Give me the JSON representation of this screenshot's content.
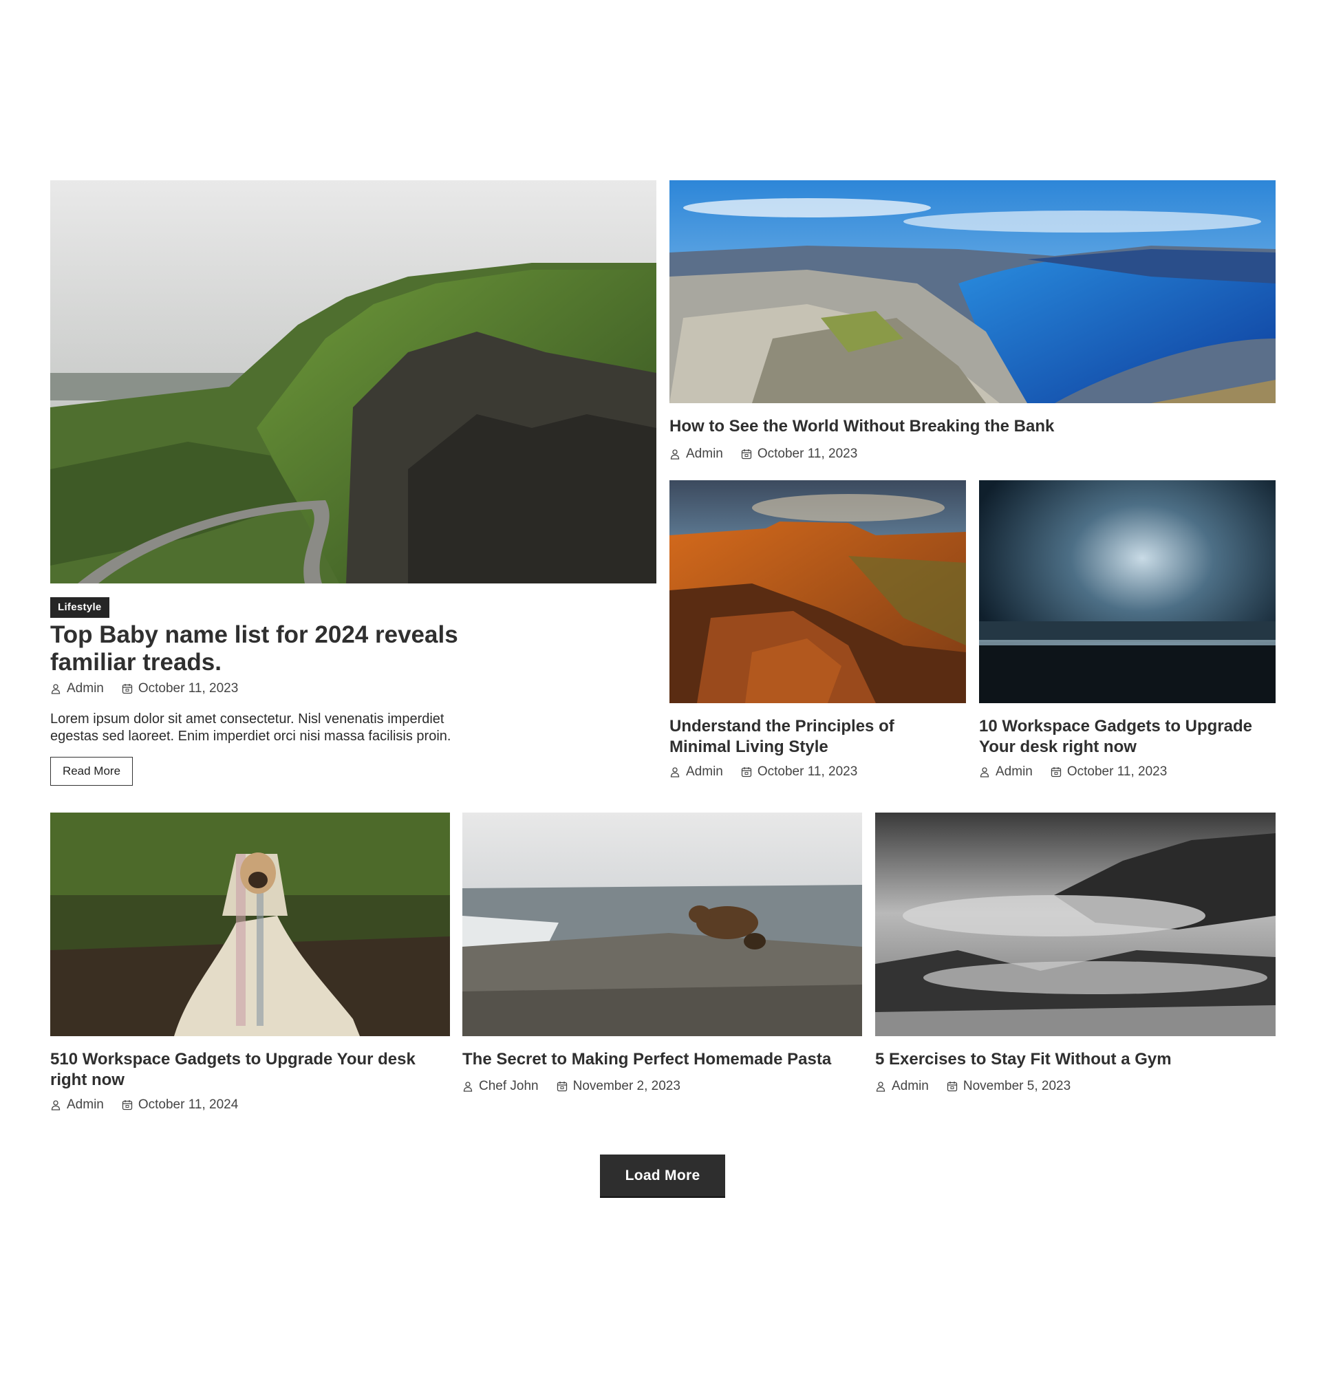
{
  "featured": {
    "category": "Lifestyle",
    "title": "Top Baby name list for 2024 reveals familiar treads.",
    "author": "Admin",
    "date": "October 11, 2023",
    "excerpt": "Lorem ipsum dolor sit amet consectetur. Nisl venenatis imperdiet egestas sed laoreet. Enim imperdiet orci nisi massa facilisis proin.",
    "read_more_label": "Read More",
    "image": "green-cliffs-road-photo"
  },
  "top_right": {
    "title": "How to See the World Without Breaking the Bank",
    "author": "Admin",
    "date": "October 11, 2023",
    "image": "fjord-cliff-photo"
  },
  "mid_left": {
    "title": "Understand the Principles of Minimal Living Style",
    "author": "Admin",
    "date": "October 11, 2023",
    "image": "red-rock-canyon-photo"
  },
  "mid_right": {
    "title": "10 Workspace Gadgets to Upgrade Your desk right now",
    "author": "Admin",
    "date": "October 11, 2023",
    "image": "storm-sea-photo"
  },
  "grid": [
    {
      "title": "510 Workspace Gadgets to Upgrade Your desk right now",
      "author": "Admin",
      "date": "October 11, 2024",
      "image": "pug-in-blanket-photo"
    },
    {
      "title": "The Secret to Making Perfect Homemade Pasta",
      "author": "Chef John",
      "date": "November 2, 2023",
      "image": "bear-with-cub-photo"
    },
    {
      "title": "5 Exercises to Stay Fit Without a Gym",
      "author": "Admin",
      "date": "November 5, 2023",
      "image": "misty-forest-bw-photo"
    }
  ],
  "load_more_label": "Load More",
  "icons": {
    "author": "user-icon",
    "date": "calendar-icon"
  }
}
